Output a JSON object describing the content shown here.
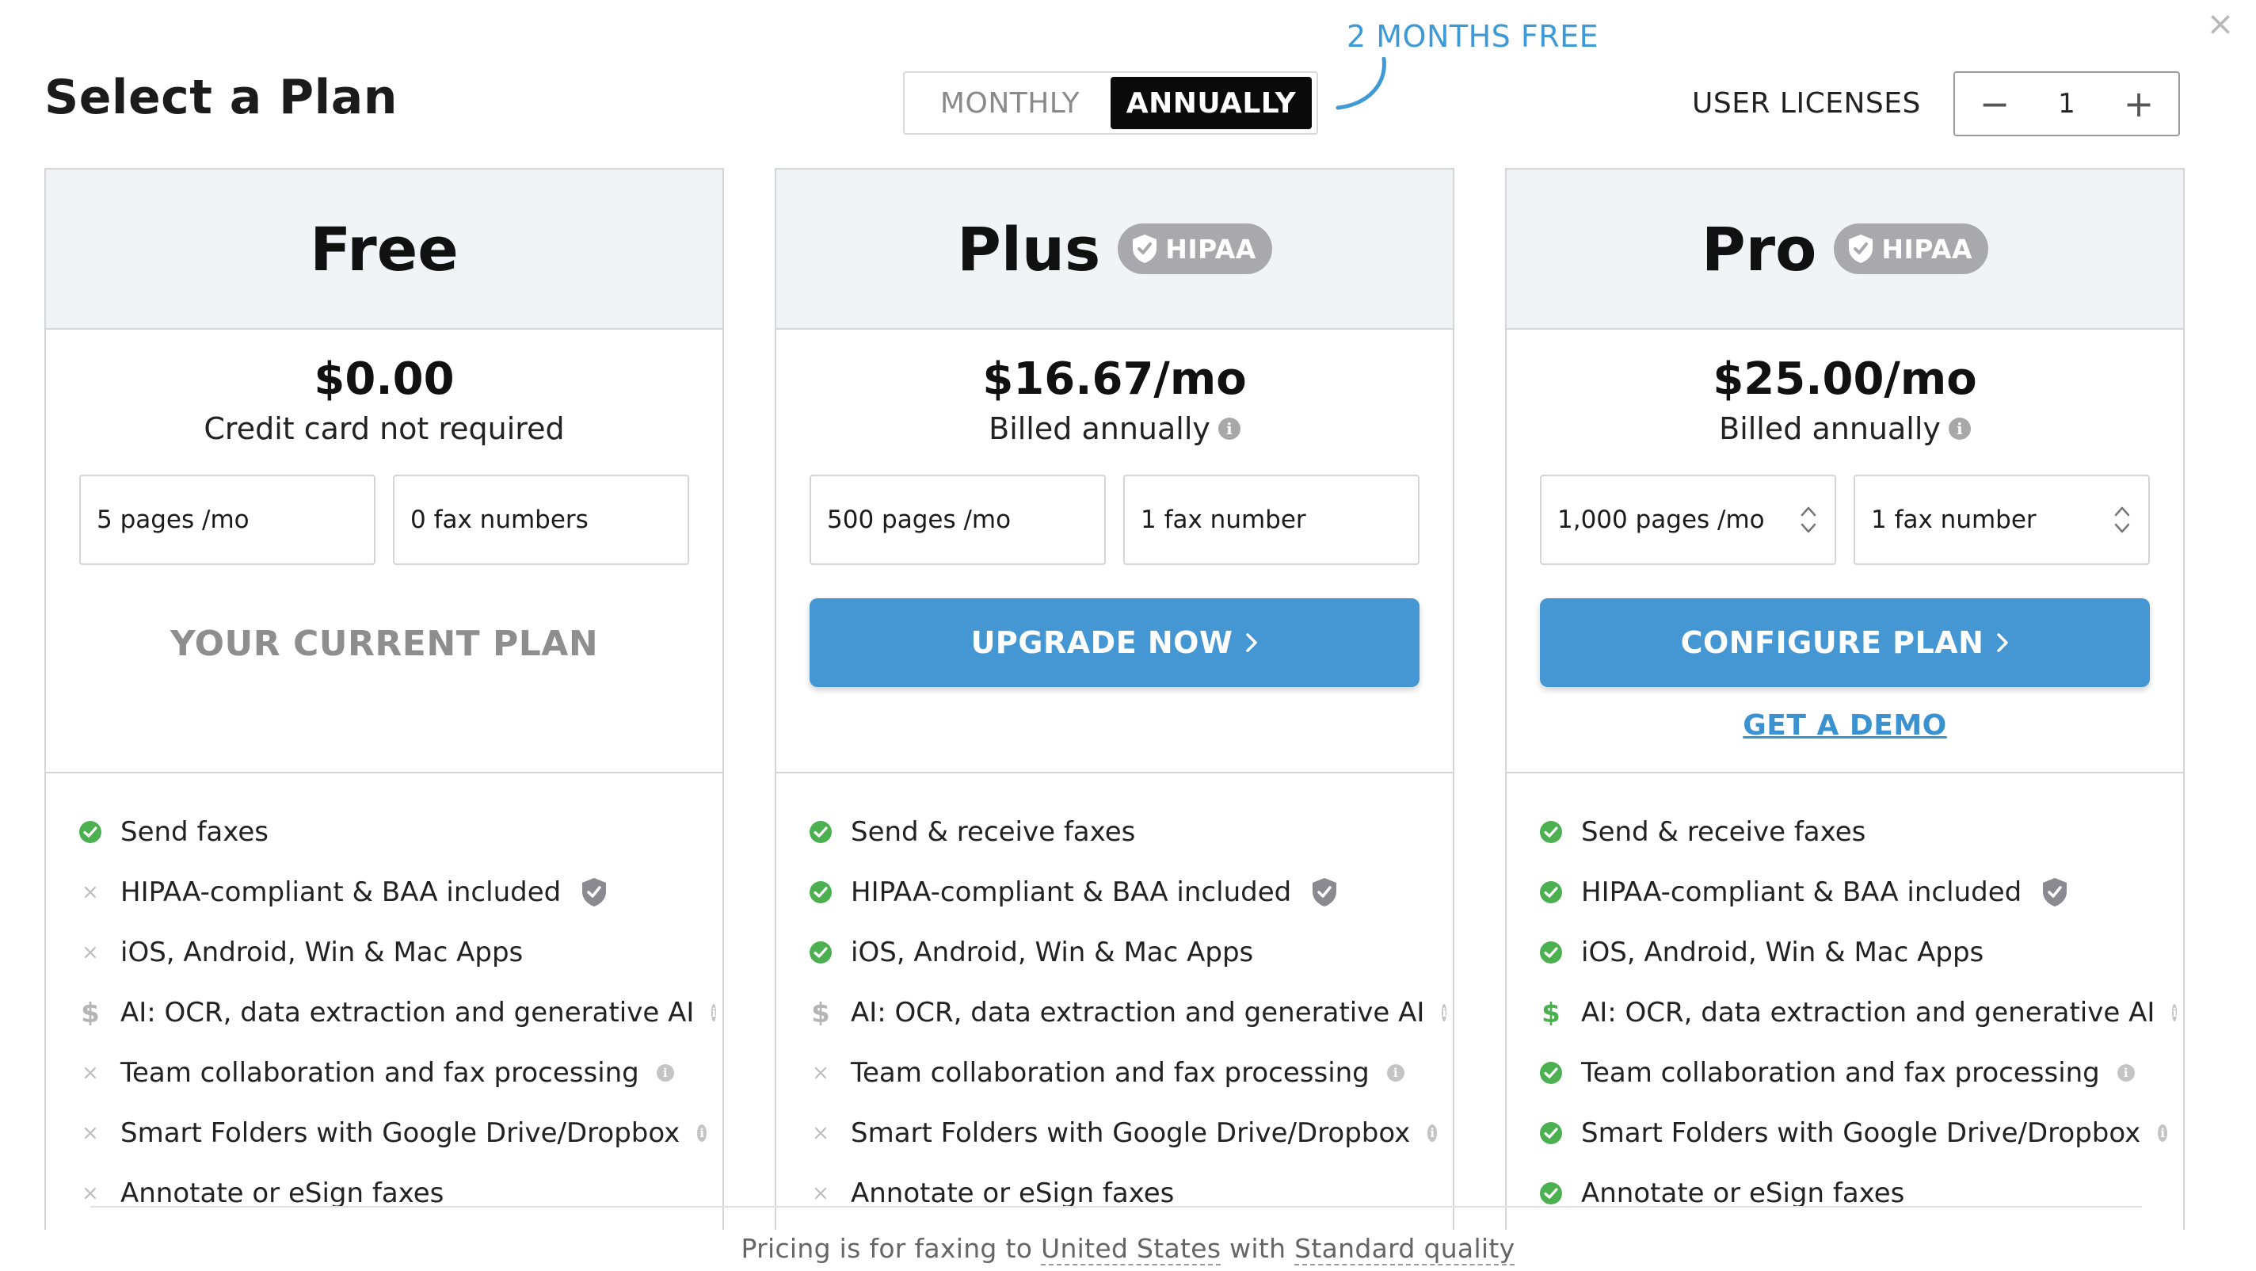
{
  "header": {
    "title": "Select a Plan",
    "promo": "2 MONTHS FREE",
    "billing_toggle": {
      "monthly": "MONTHLY",
      "annually": "ANNUALLY",
      "selected": "annually"
    },
    "licenses": {
      "label": "USER LICENSES",
      "minus": "−",
      "value": "1",
      "plus": "+"
    },
    "close": "×"
  },
  "plans": [
    {
      "name": "Free",
      "price": "$0.00",
      "sub": "Credit card not required",
      "pages": "5 pages /mo",
      "faxes": "0 fax numbers",
      "status": "YOUR CURRENT PLAN",
      "features": [
        {
          "text": "Send faxes",
          "mark": "check"
        },
        {
          "text": "HIPAA-compliant & BAA included",
          "mark": "x"
        },
        {
          "text": "iOS, Android, Win & Mac Apps",
          "mark": "x"
        },
        {
          "text": "AI: OCR, data extraction and generative AI",
          "mark": "dollar-gray"
        },
        {
          "text": "Team collaboration and fax processing",
          "mark": "x"
        },
        {
          "text": "Smart Folders with Google Drive/Dropbox",
          "mark": "x"
        },
        {
          "text": "Annotate or eSign faxes",
          "mark": "x"
        }
      ]
    },
    {
      "name": "Plus",
      "badge": "HIPAA",
      "price": "$16.67/mo",
      "sub": "Billed annually",
      "pages": "500 pages /mo",
      "faxes": "1 fax number",
      "cta": "UPGRADE NOW",
      "features": [
        {
          "text": "Send & receive faxes",
          "mark": "check"
        },
        {
          "text": "HIPAA-compliant & BAA included",
          "mark": "check"
        },
        {
          "text": "iOS, Android, Win & Mac Apps",
          "mark": "check"
        },
        {
          "text": "AI: OCR, data extraction and generative AI",
          "mark": "dollar-gray"
        },
        {
          "text": "Team collaboration and fax processing",
          "mark": "x"
        },
        {
          "text": "Smart Folders with Google Drive/Dropbox",
          "mark": "x"
        },
        {
          "text": "Annotate or eSign faxes",
          "mark": "x"
        }
      ]
    },
    {
      "name": "Pro",
      "badge": "HIPAA",
      "price": "$25.00/mo",
      "sub": "Billed annually",
      "pages": "1,000 pages /mo",
      "faxes": "1 fax number",
      "cta": "CONFIGURE PLAN",
      "demo": "GET A DEMO",
      "features": [
        {
          "text": "Send & receive faxes",
          "mark": "check"
        },
        {
          "text": "HIPAA-compliant & BAA included",
          "mark": "check"
        },
        {
          "text": "iOS, Android, Win & Mac Apps",
          "mark": "check"
        },
        {
          "text": "AI: OCR, data extraction and generative AI",
          "mark": "dollar-green"
        },
        {
          "text": "Team collaboration and fax processing",
          "mark": "check"
        },
        {
          "text": "Smart Folders with Google Drive/Dropbox",
          "mark": "check"
        },
        {
          "text": "Annotate or eSign faxes",
          "mark": "check"
        }
      ]
    }
  ],
  "footer": {
    "prefix": "Pricing is for faxing to",
    "country": "United States",
    "middle": "with",
    "quality": "Standard quality"
  },
  "colors": {
    "accent": "#4497d3",
    "check": "#4caf50",
    "badge": "#a9a9ad",
    "header_bg": "#f2f3f7"
  }
}
